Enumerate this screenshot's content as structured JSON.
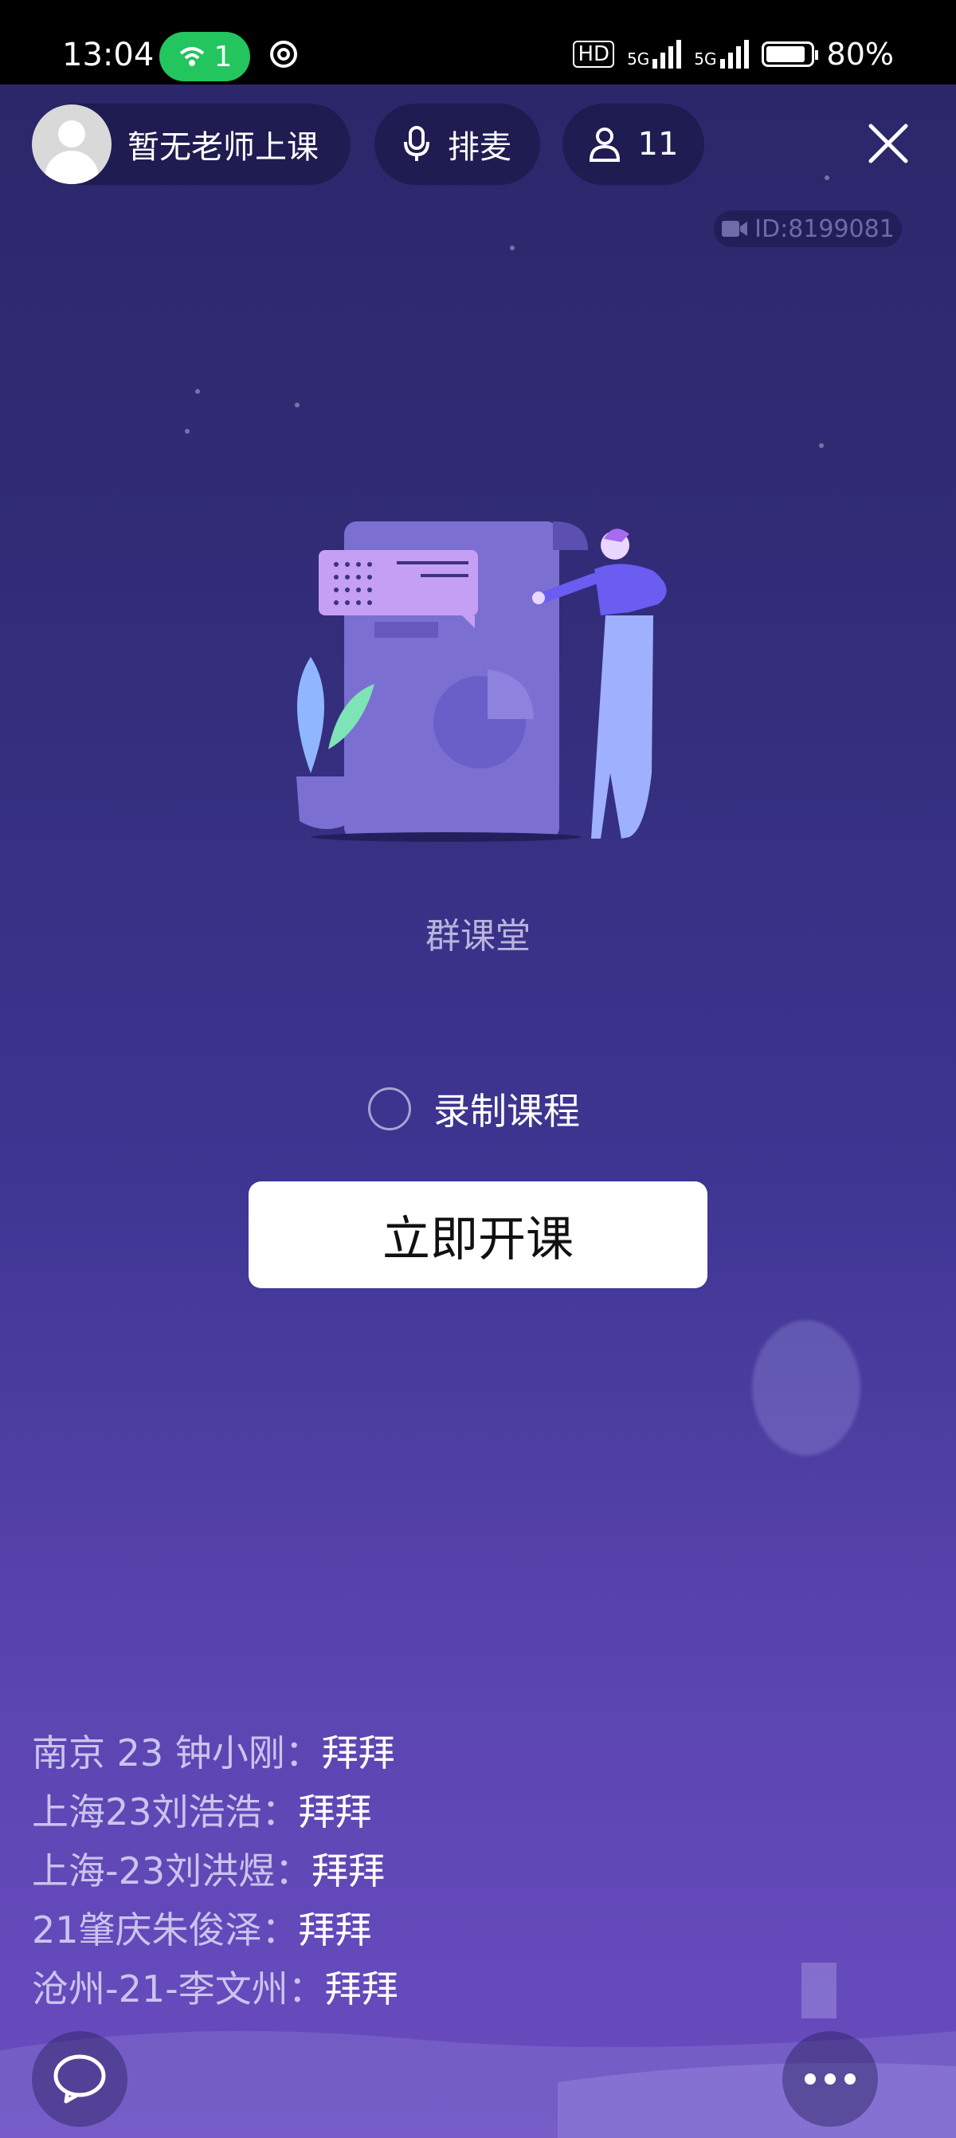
{
  "status_bar": {
    "time": "13:04",
    "hotspot_count": "1",
    "network_badge": "HD",
    "signal1": "5G",
    "signal2": "5G",
    "battery": "80%"
  },
  "header": {
    "teacher_label": "暂无老师上课",
    "mic_label": "排麦",
    "member_count": "11",
    "room_id": "ID:8199081"
  },
  "main": {
    "room_title": "群课堂",
    "record_label": "录制课程",
    "start_button": "立即开课"
  },
  "chat": [
    {
      "name": "南京 23 钟小刚：",
      "message": "拜拜"
    },
    {
      "name": "上海23刘浩浩：",
      "message": "拜拜"
    },
    {
      "name": "上海-23刘洪煜：",
      "message": "拜拜"
    },
    {
      "name": "21肇庆朱俊泽：",
      "message": "拜拜"
    },
    {
      "name": "沧州-21-李文州：",
      "message": "拜拜"
    }
  ],
  "icons": {
    "hotspot": "wifi-hotspot-icon",
    "mic": "microphone-icon",
    "user": "user-icon",
    "close": "close-icon",
    "video": "video-camera-icon",
    "chat": "chat-bubble-icon",
    "more": "more-dots-icon"
  },
  "colors": {
    "accent_green": "#22c55e",
    "bg_top": "#2b2668",
    "bg_bottom": "#6a4cc0"
  }
}
